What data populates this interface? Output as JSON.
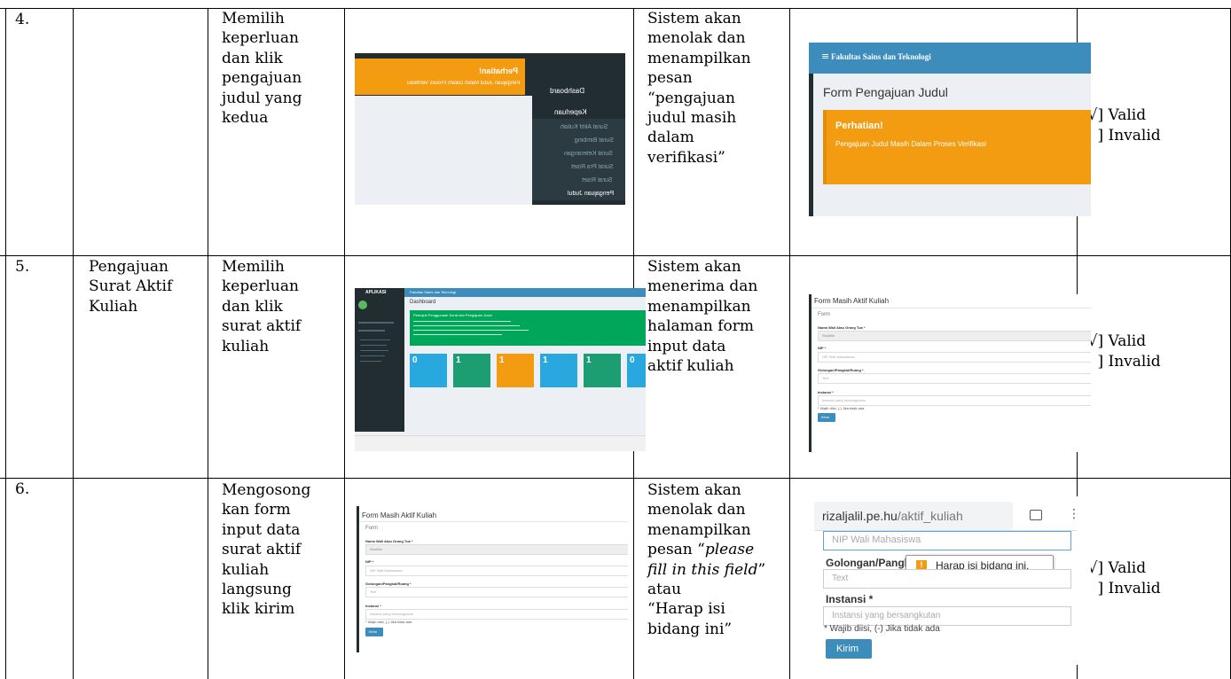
{
  "rows": [
    {
      "no": "4.",
      "scenario": "",
      "steps": "Memilih\nkeperluan\ndan klik\npengajuan\njudul yang\nkedua",
      "expected": "Sistem akan\nmenolak dan\nmenampilkan\npesan\n“pengajuan\njudul masih\ndalam\nverifikasi”",
      "valid_line": "[√] Valid",
      "invalid_line": "[  ] Invalid"
    },
    {
      "no": "5.",
      "scenario": "Pengajuan\nSurat Aktif\nKuliah",
      "steps": "Memilih\nkeperluan\ndan klik\nsurat aktif\nkuliah",
      "expected": "Sistem akan\nmenerima dan\nmenampilkan\nhalaman form\ninput data\naktif kuliah",
      "valid_line": "[√] Valid",
      "invalid_line": "[  ] Invalid"
    },
    {
      "no": "6.",
      "scenario": "",
      "steps": "Mengosong\nkan form\ninput data\nsurat aktif\nkuliah\nlangsung\nklik kirim",
      "expected_pre": "Sistem akan\nmenolak dan\nmenampilkan\npesan “",
      "expected_italic": "please\nfill in this field",
      "expected_post": "”\natau\n“Harap isi\nbidang ini”",
      "valid_line": "[√] Valid",
      "invalid_line": "[  ] Invalid"
    }
  ],
  "shot_a": {
    "notice_title": "Perhatian!",
    "notice_body": "Pengajuan Judul Masih Dalam Proses Verifikasi",
    "menu_dashboard": "Dashboard",
    "menu_keperluan": "Keperluan",
    "menu_items": [
      "Surat Aktif Kuliah",
      "Surat Bimbing",
      "Surat Keterangan",
      "Surat Pra Riset",
      "Surat Riset",
      "Pengajuan Judul"
    ]
  },
  "shot_b": {
    "header": "Fakultas Sains dan Teknologi",
    "page_title": "Form Pengajuan Judul",
    "notice_title": "Perhatian!",
    "notice_body": "Pengajuan Judul Masih Dalam Proses Verifikasi"
  },
  "shot_c": {
    "brand": "APLIKASI",
    "header": "Fakultas Sains dan Teknologi",
    "dashboard": "Dashboard",
    "panel_title": "Petunjuk Penggunaan Surat dan Pengajuan Judul",
    "cards": [
      "0",
      "1",
      "1",
      "1",
      "1",
      "0"
    ],
    "colors": [
      "#29a8e0",
      "#1c9d72",
      "#f39c12",
      "#29a8e0",
      "#1c9d72",
      "#29a8e0"
    ]
  },
  "form": {
    "title": "Form Masih Aktif Kuliah",
    "sub": "Form",
    "label_wali": "Nama Wali Atau Orang Tua *",
    "value_wali": "Sholihin",
    "label_nip": "NIP *",
    "placeholder_nip": "NIP Wali Mahasiswa",
    "label_gol": "Golongan/Pangkat/Ruang *",
    "placeholder_gol": "Text",
    "label_inst": "Instansi *",
    "placeholder_inst": "Instansi yang bersangkutan",
    "note": "* Wajib diisi, (-) Jika tidak ada",
    "button": "Kirim"
  },
  "mobile": {
    "url_host": "rizaljalil.pe.hu",
    "url_path": "/aktif_kuliah",
    "placeholder_nip": "NIP Wali Mahasiswa",
    "label_gol": "Golongan/Pangk",
    "tooltip": "Harap isi bidang ini.",
    "placeholder_gol": "Text",
    "label_inst": "Instansi *",
    "placeholder_inst": "Instansi yang bersangkutan",
    "note": "* Wajib diisi, (-) Jika tidak ada",
    "button": "Kirim"
  }
}
